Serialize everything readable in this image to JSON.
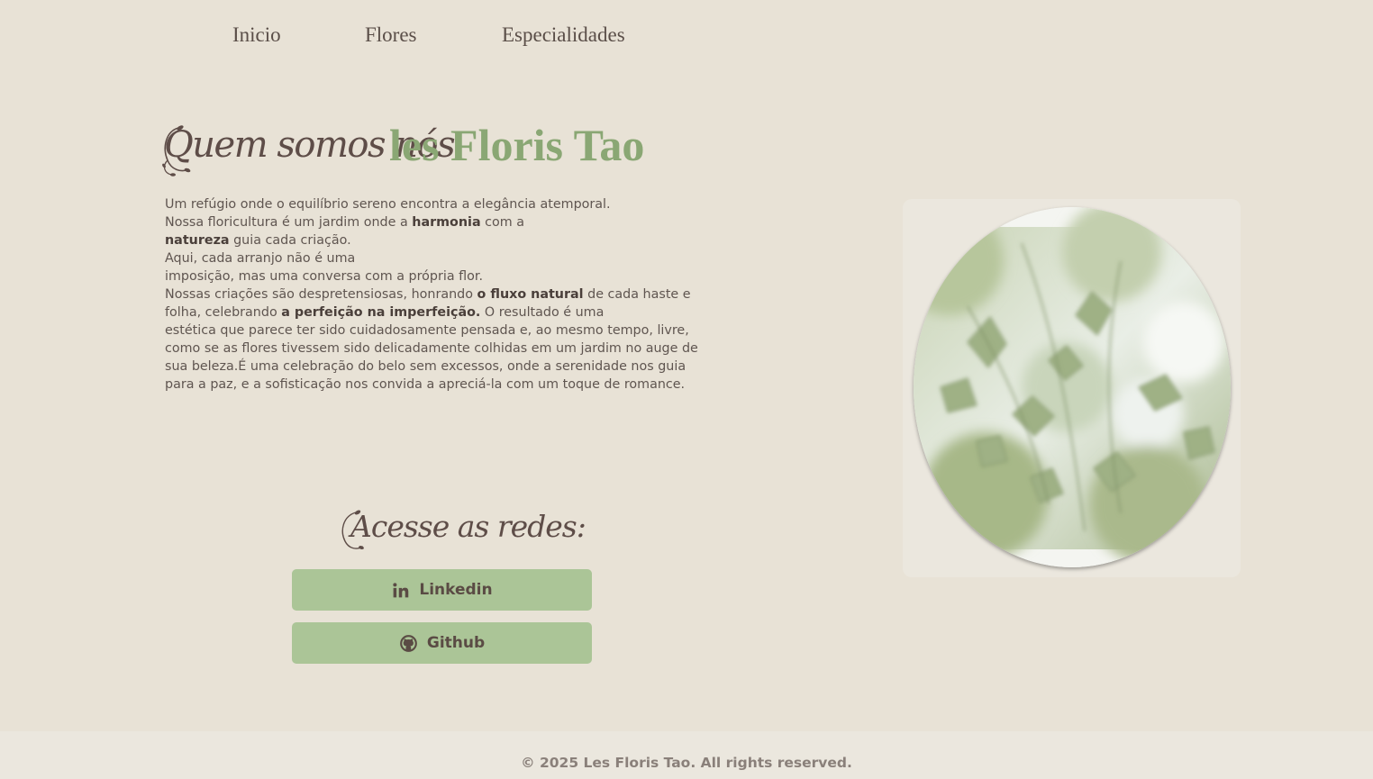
{
  "nav": {
    "items": [
      {
        "label": "Inicio"
      },
      {
        "label": "Flores"
      },
      {
        "label": "Especialidades"
      }
    ]
  },
  "hero": {
    "title_script": "Quem somos nós",
    "title_brand": "les Floris Tao"
  },
  "about": {
    "lines": [
      {
        "pre": "Um refúgio onde o equilíbrio sereno encontra a elegância atemporal.",
        "bold": "",
        "post": ""
      },
      {
        "pre": "Nossa floricultura é um jardim onde a ",
        "bold": "harmonia",
        "post": " com a "
      },
      {
        "pre": "",
        "bold": "natureza",
        "post": " guia cada criação."
      },
      {
        "pre": "Aqui, cada arranjo não é uma",
        "bold": "",
        "post": ""
      },
      {
        "pre": "imposição, mas uma conversa com a própria flor.",
        "bold": "",
        "post": ""
      },
      {
        "pre": "Nossas criações são despretensiosas, honrando ",
        "bold": "o fluxo natural",
        "post": " de cada haste e"
      },
      {
        "pre": "folha, celebrando ",
        "bold": "a perfeição na imperfeição.",
        "post": " O resultado é uma"
      },
      {
        "pre": "estética que parece ter sido cuidadosamente pensada e, ao mesmo tempo, livre,",
        "bold": "",
        "post": ""
      },
      {
        "pre": "como se as flores tivessem sido delicadamente colhidas em um jardim no auge de",
        "bold": "",
        "post": ""
      },
      {
        "pre": "sua beleza.É uma celebração do belo sem excessos, onde a serenidade nos guia",
        "bold": "",
        "post": ""
      },
      {
        "pre": "para a paz, e a sofisticação nos convida a apreciá-la com um toque de romance.",
        "bold": "",
        "post": ""
      }
    ]
  },
  "social": {
    "title": "Acesse as redes:",
    "linkedin_label": "Linkedin",
    "github_label": "Github",
    "linkedin_icon": "linkedin-icon",
    "github_icon": "github-icon"
  },
  "footer": {
    "text": "© 2025 Les Floris Tao. All rights reserved."
  },
  "colors": {
    "background": "#e8e2d6",
    "accent_green": "#8aa774",
    "button_green": "#abc597",
    "text_brown": "#5a4e48",
    "footer_bg": "#ebe7de"
  }
}
